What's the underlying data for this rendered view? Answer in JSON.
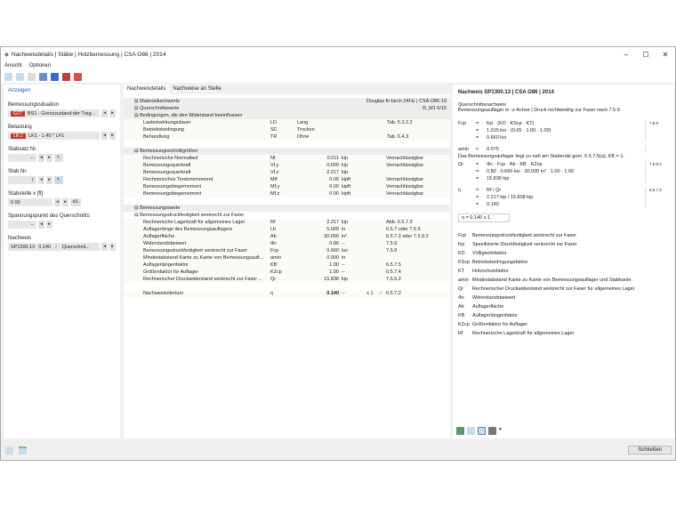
{
  "window": {
    "title": "Nachweisdetails | Stäbe | Holzbemessung | CSA O86 | 2014"
  },
  "menu": [
    "Ansicht",
    "Optionen"
  ],
  "left": {
    "section": "Anzeigen",
    "situation_label": "Bemessungssituation",
    "situation_badge": "GZT",
    "situation_value": "BS1 - Grenzzustand der Trag...",
    "load_label": "Belastung",
    "load_badge": "Lth.1",
    "load_value": "LK1 - 1.40 * LF1",
    "set_label": "Stabsatz Nr.",
    "set_value": "--",
    "member_label": "Stab Nr.",
    "member_value": "7",
    "loc_label": "Stabstelle x [ft]",
    "loc_value": "0.00",
    "stress_label": "Spannungspunkt des Querschnitts",
    "stress_value": "--",
    "check_label": "Nachweis",
    "check_id": "SP1300.13",
    "check_ratio": "0.140",
    "check_type": "Querschnit..."
  },
  "tabs": [
    "Nachweisdetails",
    "Nachweise an Stelle"
  ],
  "rows": [
    {
      "t": "g",
      "name": "Materialkennwerte",
      "ref": "Douglas fir-larch 24f-E | CSA O86-19"
    },
    {
      "t": "g",
      "name": "Querschnittswerte",
      "ref": "R_M1 6/15"
    },
    {
      "t": "g",
      "name": "Bedingungen, die den Widerstand beeinflussen"
    },
    {
      "t": "s",
      "name": "Lasteinwirkungsdauer",
      "sym": "LD",
      "val": "Lang",
      "ref": "Tab. 5.3.2.2"
    },
    {
      "t": "s",
      "name": "Betriebsbedingung",
      "sym": "SC",
      "val": "Trocken"
    },
    {
      "t": "s",
      "name": "Behandlung",
      "sym": "TR",
      "val": "Ohne",
      "ref": "Tab. 6.4.3"
    },
    {
      "t": "b"
    },
    {
      "t": "g",
      "name": "Bemessungsschnittgrößen"
    },
    {
      "t": "s",
      "name": "Rechnerische Normallast",
      "sym": "Nf",
      "num": "0.011",
      "unit": "kip",
      "ref": "Vernachlässigbar"
    },
    {
      "t": "s",
      "name": "Bemessungsquerkraft",
      "sym": "Vf,y",
      "num": "0.000",
      "unit": "kip",
      "ref": "Vernachlässigbar"
    },
    {
      "t": "s",
      "name": "Bemessungsquerkraft",
      "sym": "Vf,z",
      "num": "2.217",
      "unit": "kip"
    },
    {
      "t": "s",
      "name": "Rechnerisches Torsionsmoment",
      "sym": "Mtf",
      "num": "0.00",
      "unit": "kipft",
      "ref": "Vernachlässigbar"
    },
    {
      "t": "s",
      "name": "Bemessungsbiegemoment",
      "sym": "Mf,y",
      "num": "0.00",
      "unit": "kipft",
      "ref": "Vernachlässigbar"
    },
    {
      "t": "s",
      "name": "Bemessungsbiegemoment",
      "sym": "Mf,z",
      "num": "0.00",
      "unit": "kipft",
      "ref": "Vernachlässigbar"
    },
    {
      "t": "b"
    },
    {
      "t": "g",
      "name": "Bemessungswerte"
    },
    {
      "t": "g2",
      "name": "Bemessungsdruckfestigkeit senkrecht zur Faser"
    },
    {
      "t": "s",
      "name": "Rechnerische Lagerkraft für allgemeines Lager",
      "sym": "Rf",
      "num": "2.217",
      "unit": "kip",
      "ref": "Abb. 6.5.7.3"
    },
    {
      "t": "s",
      "name": "Auflagerlänge des Bemessungsauflagers",
      "sym": "Lb",
      "num": "5.000",
      "unit": "in",
      "ref": "6.5.7 oder 7.5.9"
    },
    {
      "t": "s",
      "name": "Auflagerfläche",
      "sym": "Ab",
      "num": "30.000",
      "unit": "in²",
      "ref": "6.5.7.2 oder 7.5.9.2"
    },
    {
      "t": "s",
      "name": "Widerstandsbeiwert",
      "sym": "Φc",
      "num": "0.80",
      "unit": "--",
      "ref": "7.5.9"
    },
    {
      "t": "s",
      "name": "Bemessungsdruckfestigkeit senkrecht zur Faser",
      "sym": "Fcp",
      "num": "0.660",
      "unit": "ksi",
      "ref": "7.5.9"
    },
    {
      "t": "s",
      "name": "Mindestabstand Kante zu Kante von Bemessungsaufl...",
      "sym": "amin",
      "num": "0.000",
      "unit": "in"
    },
    {
      "t": "s",
      "name": "Auflagerlängenfaktor",
      "sym": "KB",
      "num": "1.00",
      "unit": "--",
      "ref": "6.5.7.5"
    },
    {
      "t": "s",
      "name": "Größenfaktor für Auflager",
      "sym": "KZcp",
      "num": "1.00",
      "unit": "--",
      "ref": "6.5.7.4"
    },
    {
      "t": "s",
      "name": "Rechnerischer Druckwiderstand senkrecht zur Faser ...",
      "sym": "Qr",
      "num": "15.838",
      "unit": "kip",
      "ref": "7.5.9.2"
    },
    {
      "t": "b"
    },
    {
      "t": "s",
      "name": "Nachweiskriterium",
      "sym": "η",
      "num": "0.140",
      "unit": "--",
      "lim": "≤ 1",
      "ref": "6.5.7.2"
    }
  ],
  "right": {
    "title": "Nachweis SP1300.13 | CSA O86 | 2014",
    "sub1": "Querschnittsnachweis",
    "sub2": "Bemessungsauflager in -z-Achse | Druck rechtwinklig zur Faser nach 7.5.9",
    "eqs": [
      {
        "v": "Fcp",
        "o": "=",
        "r": "fcp · (KD · KScp · KT)",
        "ref": "7.5.9"
      },
      {
        "o": "=",
        "r": "1.015 ksi · (0.65 · 1.00 · 1.00)"
      },
      {
        "o": "=",
        "r": "0.660 ksi"
      },
      {
        "gap": true
      },
      {
        "v": "amin",
        "o": "<",
        "r": "0.075"
      },
      {
        "note": "Das Bemessungsauflager liegt zu nah am Stabende gem. 6.5.7.5(a), KB = 1."
      },
      {
        "v": "Qr",
        "o": "=",
        "r": "Φc · Fcp · Ab · KB · KZcp",
        "ref": "7.5.9.2"
      },
      {
        "o": "=",
        "r": "0.80 · 0.660 ksi · 30.000 in² · 1.00 · 1.00"
      },
      {
        "o": "=",
        "r": "15.838 kip"
      },
      {
        "gap": true
      },
      {
        "v": "η",
        "o": "=",
        "r": "Rf / Qr",
        "ref": "6.5.7.2"
      },
      {
        "o": "=",
        "r": "2.217 kip / 15.838 kip"
      },
      {
        "o": "=",
        "r": "0.140"
      }
    ],
    "result": "η  =  0.140  ≤ 1",
    "legend": [
      [
        "Fcp",
        "Bemessungsdruckfestigkeit senkrecht zur Faser"
      ],
      [
        "fcp",
        "Spezifizierte Druckfestigkeit senkrecht zur Faser"
      ],
      [
        "KD",
        "Völligkeitsfaktor"
      ],
      [
        "KScp",
        "Betriebsbedingungsfaktor"
      ],
      [
        "KT",
        "Holzschutzfaktor"
      ],
      [
        "amin",
        "Mindestabstand Kante zu Kante von Bemessungsauflager und Stabkante"
      ],
      [
        "Qr",
        "Rechnerischer Druckwiderstand senkrecht zur Faser für allgemeines Lager"
      ],
      [
        "Φc",
        "Widerstandsbeiwert"
      ],
      [
        "Ab",
        "Auflagerfläche"
      ],
      [
        "KB",
        "Auflagerlängenfaktor"
      ],
      [
        "KZcp",
        "Größenfaktor für Auflager"
      ],
      [
        "Rf",
        "Rechnerische Lagerkraft für allgemeines Lager"
      ]
    ]
  },
  "footer": {
    "close": "Schließen"
  }
}
